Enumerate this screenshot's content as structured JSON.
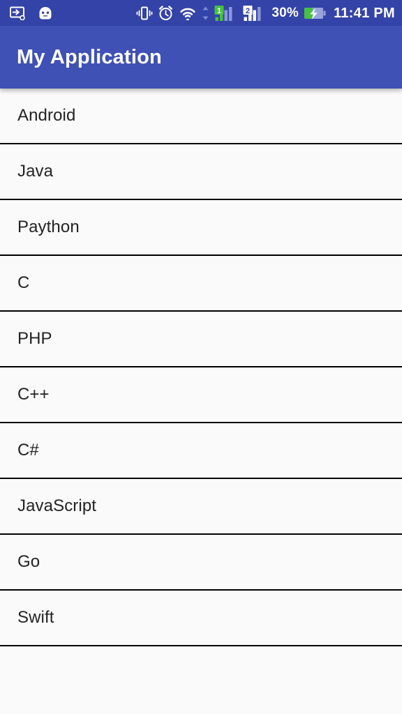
{
  "status_bar": {
    "left_icons": [
      {
        "name": "screen-cast-icon",
        "label": "screen-cast"
      },
      {
        "name": "android-head-icon",
        "label": "android-bugdroid"
      }
    ],
    "right_icons": [
      {
        "name": "vibrate-icon",
        "label": "vibrate"
      },
      {
        "name": "alarm-clock-icon",
        "label": "alarm"
      },
      {
        "name": "wifi-icon",
        "label": "wifi"
      },
      {
        "name": "data-transfer-arrows-icon",
        "label": "data-transfer"
      },
      {
        "name": "sim1-signal-icon",
        "label": "sim-1-signal"
      },
      {
        "name": "sim2-signal-icon",
        "label": "sim-2-signal"
      }
    ],
    "sim1_badge": "1",
    "sim2_badge": "2",
    "battery_percent": "30%",
    "battery_icon": "battery-charging-icon",
    "time": "11:41 PM",
    "background_color": "#3343A8",
    "foreground_color": "#FFFFFF",
    "battery_fill_color": "#3FC03F"
  },
  "app_bar": {
    "title": "My Application",
    "background_color": "#3F51B5",
    "title_color": "#FFFFFF"
  },
  "list": {
    "background_color": "#FAFAFA",
    "divider_color": "#000000",
    "text_color": "#232323",
    "items": [
      {
        "label": "Android"
      },
      {
        "label": "Java"
      },
      {
        "label": "Paython"
      },
      {
        "label": "C"
      },
      {
        "label": "PHP"
      },
      {
        "label": "C++"
      },
      {
        "label": "C#"
      },
      {
        "label": "JavaScript"
      },
      {
        "label": "Go"
      },
      {
        "label": "Swift"
      }
    ]
  }
}
